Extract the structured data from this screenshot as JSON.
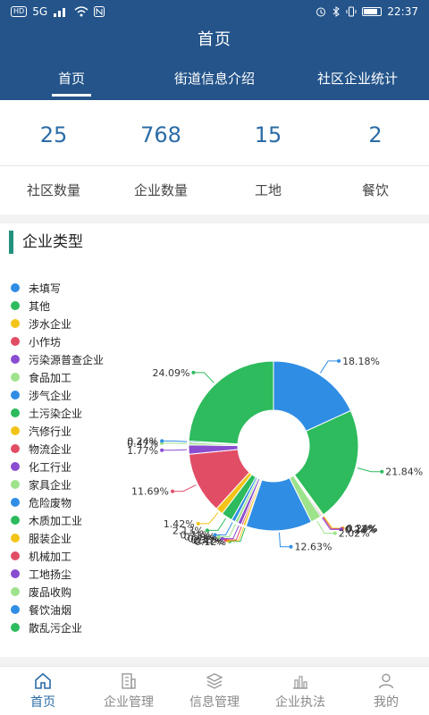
{
  "status": {
    "left_tags": [
      "HD",
      "5G"
    ],
    "time": "22:37"
  },
  "header": {
    "title": "首页",
    "tabs": [
      {
        "label": "首页"
      },
      {
        "label": "街道信息介绍"
      },
      {
        "label": "社区企业统计"
      }
    ]
  },
  "stats": [
    {
      "value": "25",
      "label": "社区数量"
    },
    {
      "value": "768",
      "label": "企业数量"
    },
    {
      "value": "15",
      "label": "工地"
    },
    {
      "value": "2",
      "label": "餐饮"
    }
  ],
  "card": {
    "title": "企业类型"
  },
  "chart_data": {
    "type": "pie",
    "categories": [
      "未填写",
      "其他",
      "涉水企业",
      "小作坊",
      "污染源普查企业",
      "食品加工",
      "涉气企业",
      "土污染企业",
      "汽修行业",
      "物流企业",
      "化工行业",
      "家具企业",
      "危险废物",
      "木质加工业",
      "服装企业",
      "机械加工",
      "工地扬尘",
      "废品收购",
      "餐饮油烟",
      "散乱污企业"
    ],
    "colors": [
      "#2f8de4",
      "#2dbb5d",
      "#f3c418",
      "#e24d66",
      "#8a4dd0",
      "#9ee38c",
      "#2f8de4",
      "#2dbb5d",
      "#f3c418",
      "#e24d66",
      "#8a4dd0",
      "#9ee38c",
      "#2f8de4",
      "#2dbb5d",
      "#f3c418",
      "#e24d66",
      "#8a4dd0",
      "#9ee38c",
      "#2f8de4",
      "#2dbb5d"
    ],
    "values": [
      18.18,
      21.84,
      0.24,
      0.12,
      0.24,
      2.02,
      12.63,
      0.12,
      0.47,
      0.35,
      0.71,
      0.59,
      0.71,
      2.13,
      1.42,
      11.69,
      1.77,
      0.47,
      0.24,
      24.09
    ],
    "labels": [
      "18.18%",
      "21.84%",
      "0.24%",
      "0.12%",
      "0.24%",
      "2.02%",
      "12.63%",
      "0.12%",
      "0.47%",
      "0.35%",
      "0.71%",
      "0.59%",
      "0.71%",
      "2.13%",
      "1.42%",
      "11.69%",
      "1.77%",
      "0.47%",
      "0.24%",
      "24.09%"
    ],
    "legend_placement": "left"
  },
  "bottom_nav": [
    {
      "label": "首页",
      "icon": "home-icon"
    },
    {
      "label": "企业管理",
      "icon": "building-icon"
    },
    {
      "label": "信息管理",
      "icon": "layers-icon"
    },
    {
      "label": "企业执法",
      "icon": "bar-chart-icon"
    },
    {
      "label": "我的",
      "icon": "user-icon"
    }
  ]
}
